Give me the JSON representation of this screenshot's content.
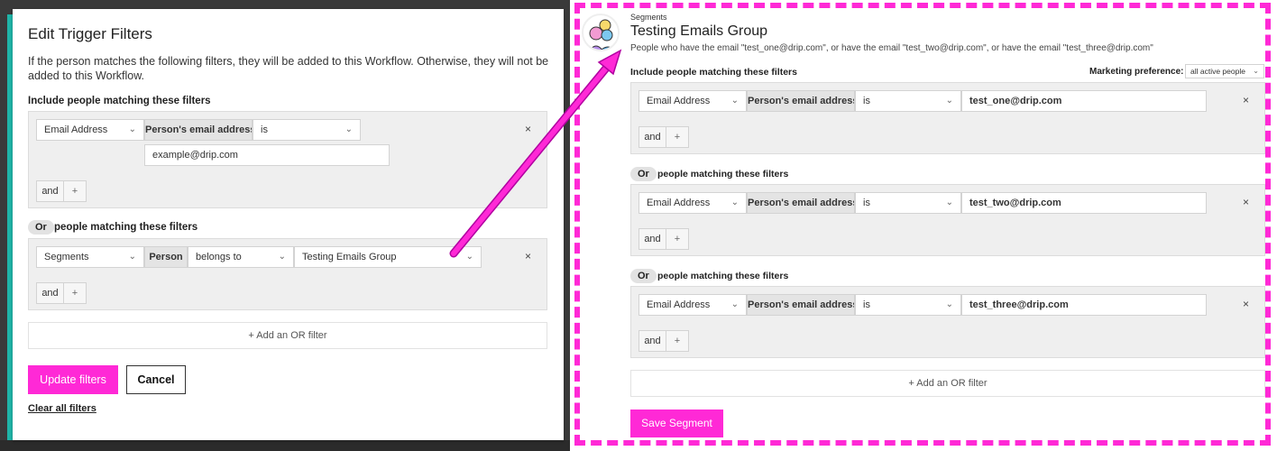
{
  "modal": {
    "title": "Edit Trigger Filters",
    "description": "If the person matches the following filters, they will be added to this Workflow. Otherwise, they will not be added to this Workflow.",
    "include_label": "Include people matching these filters",
    "filter1": {
      "field": "Email Address",
      "subject": "Person's email address",
      "operator": "is",
      "value": "example@drip.com"
    },
    "or_label": "Or",
    "or_text": "people matching these filters",
    "filter2": {
      "field": "Segments",
      "subject": "Person",
      "operator": "belongs to",
      "value": "Testing Emails Group"
    },
    "and_label": "and",
    "plus_label": "+",
    "remove_label": "×",
    "add_or_label": "+   Add an OR filter",
    "update_label": "Update filters",
    "cancel_label": "Cancel",
    "clear_label": "Clear all filters"
  },
  "segment": {
    "breadcrumb": "Segments",
    "title": "Testing Emails Group",
    "description": "People who have the email \"test_one@drip.com\", or have the email \"test_two@drip.com\", or have the email \"test_three@drip.com\"",
    "include_label": "Include people matching these filters",
    "pref_label": "Marketing preference:",
    "pref_value": "all active people",
    "field": "Email Address",
    "subject": "Person's email address",
    "operator": "is",
    "values": [
      "test_one@drip.com",
      "test_two@drip.com",
      "test_three@drip.com"
    ],
    "or_label": "Or",
    "or_text": "people matching these filters",
    "and_label": "and",
    "plus_label": "+",
    "remove_label": "×",
    "add_or_label": "+   Add an OR filter",
    "save_label": "Save Segment"
  },
  "colors": {
    "accent": "#ff29d6",
    "teal": "#1fb5a8"
  },
  "icons": {
    "chevron": "chevron-down-icon",
    "remove": "close-icon",
    "arrow": "annotation-arrow-icon"
  }
}
